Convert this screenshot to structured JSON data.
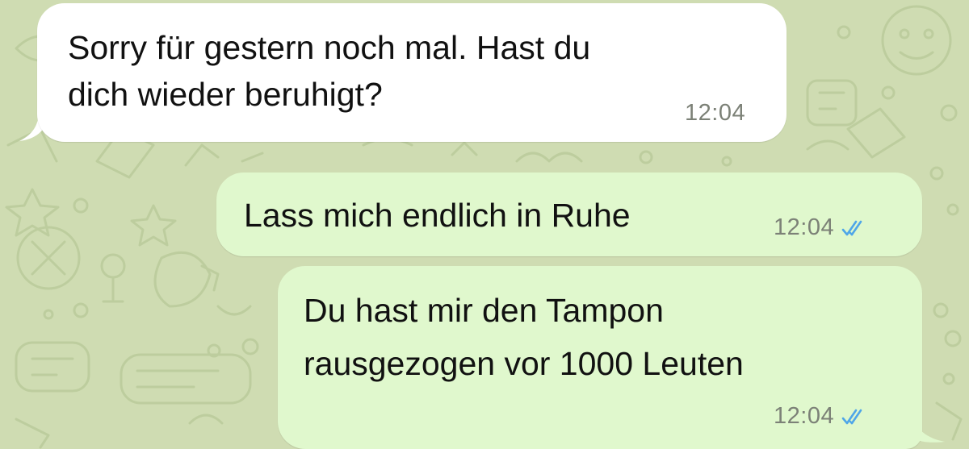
{
  "chat": {
    "messages": [
      {
        "direction": "incoming",
        "text": "Sorry für gestern noch mal. Hast du\ndich wieder beruhigt?",
        "time": "12:04"
      },
      {
        "direction": "outgoing",
        "text": "Lass mich endlich in Ruhe",
        "time": "12:04",
        "status": "read"
      },
      {
        "direction": "outgoing",
        "text": "Du hast mir den Tampon\nrausgezogen vor 1000 Leuten",
        "time": "12:04",
        "status": "read"
      }
    ]
  },
  "colors": {
    "wallpaper": "#cfdcb2",
    "incoming_bubble": "#ffffff",
    "outgoing_bubble": "#e0f8cd",
    "read_ticks": "#4fa6e8",
    "timestamp": "#7c8177"
  },
  "icons": {
    "read_status": "double-check-icon"
  }
}
